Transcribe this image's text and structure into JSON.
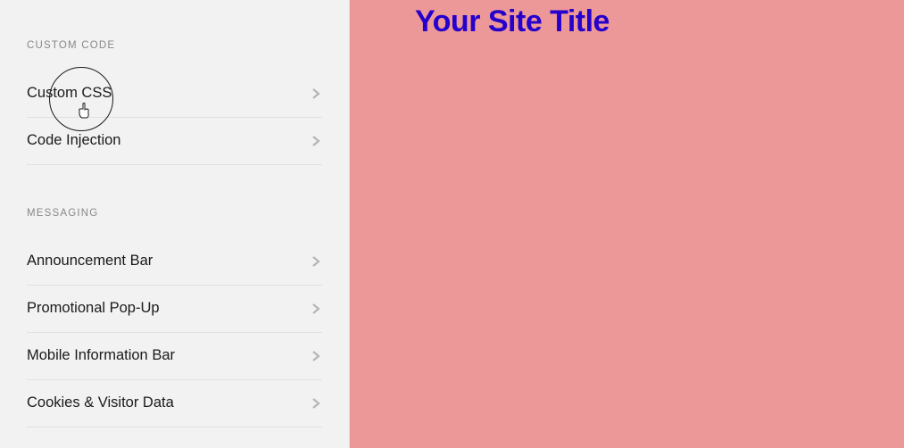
{
  "sidebar": {
    "sections": [
      {
        "header": "CUSTOM CODE",
        "items": [
          {
            "label": "Custom CSS"
          },
          {
            "label": "Code Injection"
          }
        ]
      },
      {
        "header": "MESSAGING",
        "items": [
          {
            "label": "Announcement Bar"
          },
          {
            "label": "Promotional Pop-Up"
          },
          {
            "label": "Mobile Information Bar"
          },
          {
            "label": "Cookies & Visitor Data"
          }
        ]
      }
    ]
  },
  "preview": {
    "site_title": "Your Site Title",
    "background_color": "#ed9898",
    "title_color": "#2500cc"
  }
}
